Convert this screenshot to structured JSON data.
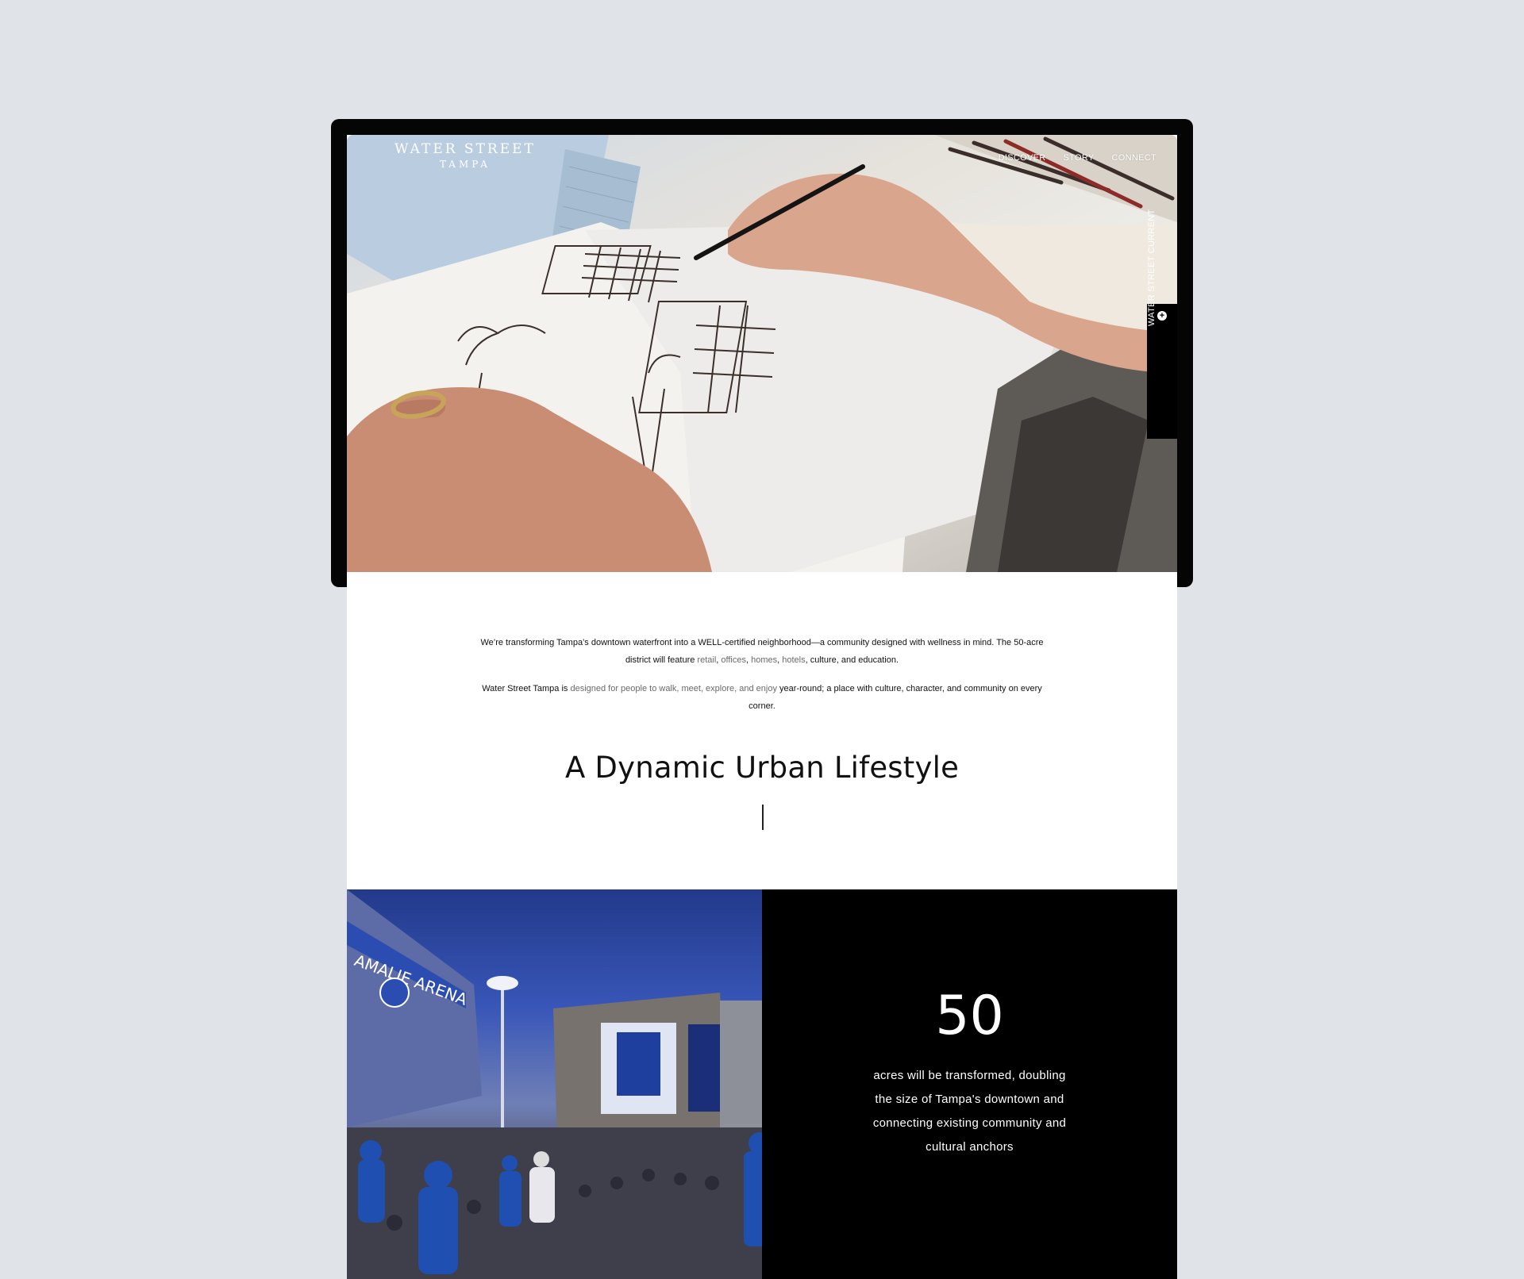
{
  "brand": {
    "line1": "WATER STREET",
    "line2": "TAMPA"
  },
  "nav": {
    "discover": "DISCOVER",
    "story": "STORY",
    "connect": "CONNECT"
  },
  "side_tab": {
    "label": "WATER STREET CURRENT",
    "icon": "plus-circle-icon"
  },
  "intro": {
    "p1_a": "We’re transforming Tampa’s downtown waterfront into a WELL-certified neighborhood—a community designed with wellness in mind. The 50-acre district will feature ",
    "retail": "retail",
    "sep1": ", ",
    "offices": "offices",
    "sep2": ", ",
    "homes": "homes",
    "sep3": ", ",
    "hotels": "hotels",
    "p1_b": ", culture, and education.",
    "p2_a": "Water Street Tampa is ",
    "p2_link": "designed for people to walk, meet, explore, and enjoy",
    "p2_b": " year-round; a place with culture, character, and community on every corner."
  },
  "headline": "A Dynamic Urban Lifestyle",
  "stat": {
    "number": "50",
    "description": "acres will be transformed, doubling the size of Tampa's downtown and connecting existing community and cultural anchors"
  },
  "photo": {
    "sign_text": "AMALIE ARENA"
  },
  "colors": {
    "page_bg": "#e0e3e8",
    "frame": "#050505",
    "stat_bg": "#000000",
    "muted_link": "#6a6a6a"
  }
}
